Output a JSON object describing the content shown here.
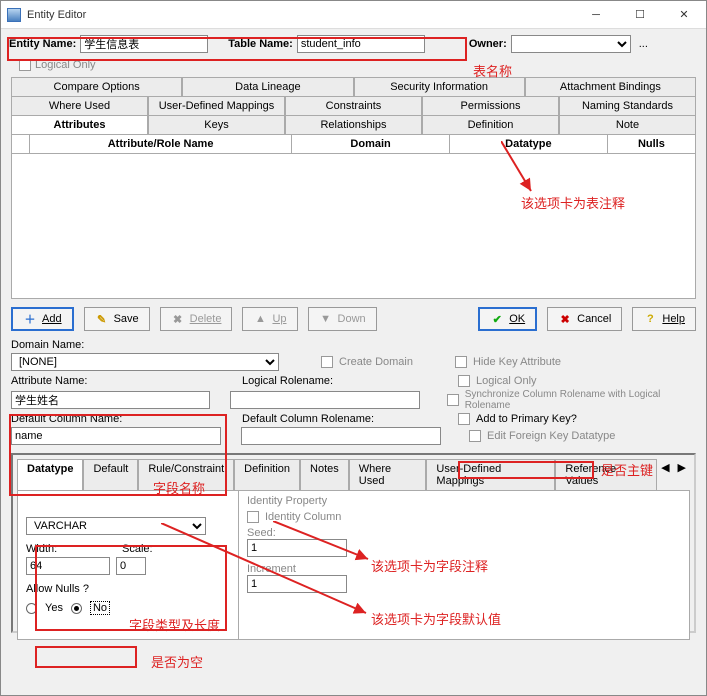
{
  "window": {
    "title": "Entity Editor"
  },
  "header": {
    "entity_lbl": "Entity Name:",
    "entity_val": "学生信息表",
    "table_lbl": "Table Name:",
    "table_val": "student_info",
    "owner_lbl": "Owner:",
    "logical_only": "Logical Only"
  },
  "anno": {
    "table_name": "表名称",
    "tab_is_table_comment": "该选项卡为表注释",
    "field_name": "字段名称",
    "is_pk": "是否主键",
    "dtype_len": "字段类型及长度",
    "field_comment": "该选项卡为字段注释",
    "field_default": "该选项卡为字段默认值",
    "is_null": "是否为空"
  },
  "tabs_row1": [
    "Compare Options",
    "Data Lineage",
    "Security Information",
    "Attachment Bindings"
  ],
  "tabs_row2": [
    "Where Used",
    "User-Defined Mappings",
    "Constraints",
    "Permissions",
    "Naming Standards"
  ],
  "tabs_row3": [
    "Attributes",
    "Keys",
    "Relationships",
    "Definition",
    "Note"
  ],
  "cols": {
    "attr": "Attribute/Role Name",
    "domain": "Domain",
    "datatype": "Datatype",
    "nulls": "Nulls"
  },
  "buttons": {
    "add": "Add",
    "save": "Save",
    "delete": "Delete",
    "up": "Up",
    "down": "Down",
    "ok": "OK",
    "cancel": "Cancel",
    "help": "Help"
  },
  "mid": {
    "domain_name_lbl": "Domain Name:",
    "domain_name_val": "[NONE]",
    "create_domain": "Create Domain",
    "hide_key": "Hide Key Attribute",
    "attr_name_lbl": "Attribute Name:",
    "attr_name_val": "学生姓名",
    "logical_role_lbl": "Logical Rolename:",
    "logical_only": "Logical Only",
    "sync": "Synchronize Column Rolename with Logical Rolename",
    "def_col_lbl": "Default Column Name:",
    "def_col_val": "name",
    "def_col_role_lbl": "Default Column Rolename:",
    "add_pk": "Add to Primary Key?",
    "edit_fk": "Edit Foreign Key Datatype"
  },
  "lower_tabs": [
    "Datatype",
    "Default",
    "Rule/Constraint",
    "Definition",
    "Notes",
    "Where Used",
    "User-Defined Mappings",
    "Reference Values"
  ],
  "dtype": {
    "type_val": "VARCHAR",
    "width_lbl": "Width:",
    "width_val": "64",
    "scale_lbl": "Scale:",
    "scale_val": "0",
    "allow_lbl": "Allow Nulls ?",
    "yes": "Yes",
    "no": "No",
    "identity_grp": "Identity Property",
    "identity_col": "Identity Column",
    "seed_lbl": "Seed:",
    "seed_val": "1",
    "incr_lbl": "Increment",
    "incr_val": "1"
  }
}
